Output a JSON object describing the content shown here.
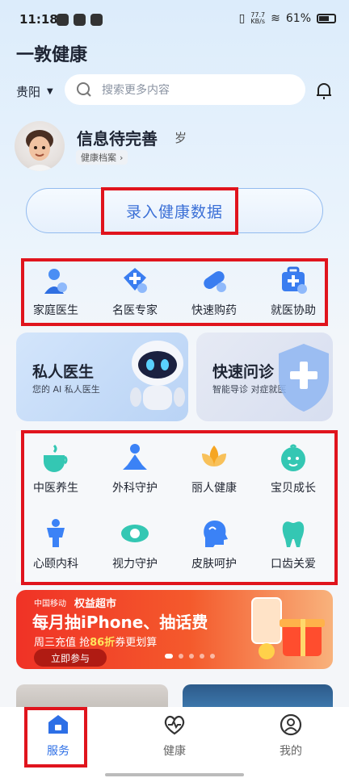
{
  "status_bar": {
    "time": "11:18",
    "speed_top": "77.7",
    "speed_bottom": "KB/s",
    "battery": "61%"
  },
  "app": {
    "title": "一敦健康"
  },
  "header": {
    "city": "贵阳",
    "search_placeholder": "搜索更多内容"
  },
  "profile": {
    "name": "信息待完善",
    "age_suffix": "岁",
    "archive_label": "健康档案",
    "archive_arrow": "›"
  },
  "record_button": {
    "label": "录入健康数据"
  },
  "services": [
    {
      "label": "家庭医生",
      "icon": "doctor-icon"
    },
    {
      "label": "名医专家",
      "icon": "expert-cross-icon"
    },
    {
      "label": "快速购药",
      "icon": "pill-icon"
    },
    {
      "label": "就医协助",
      "icon": "medical-kit-icon"
    }
  ],
  "banners": {
    "private_doctor": {
      "title": "私人医生",
      "subtitle": "您的 AI 私人医生"
    },
    "quick_consult": {
      "title": "快速问诊",
      "subtitle": "智能导诊 对症就医"
    }
  },
  "departments": [
    {
      "label": "中医养生",
      "icon": "tea-cup-icon"
    },
    {
      "label": "外科守护",
      "icon": "meditation-person-icon"
    },
    {
      "label": "丽人健康",
      "icon": "lotus-icon"
    },
    {
      "label": "宝贝成长",
      "icon": "baby-face-icon"
    },
    {
      "label": "心颐内科",
      "icon": "person-body-icon"
    },
    {
      "label": "视力守护",
      "icon": "eye-icon"
    },
    {
      "label": "皮肤呵护",
      "icon": "face-profile-icon"
    },
    {
      "label": "口齿关爱",
      "icon": "tooth-icon"
    }
  ],
  "promo": {
    "brand": "中国移动",
    "store": "权益超市",
    "title": "每月抽iPhone、抽话费",
    "sub_prefix": "周三充值 抢",
    "sub_highlight": "86折",
    "sub_suffix": "券更划算",
    "button": "立即参与",
    "page_index": 1,
    "page_count": 5
  },
  "tabs": [
    {
      "label": "服务",
      "icon": "home-icon",
      "active": true
    },
    {
      "label": "健康",
      "icon": "heart-pulse-icon",
      "active": false
    },
    {
      "label": "我的",
      "icon": "user-icon",
      "active": false
    }
  ],
  "colors": {
    "accent": "#2d6fe6",
    "highlight_box": "#e0141d",
    "icon_teal": "#34c7b3",
    "icon_blue": "#3b82f6",
    "icon_orange": "#f6a623"
  }
}
